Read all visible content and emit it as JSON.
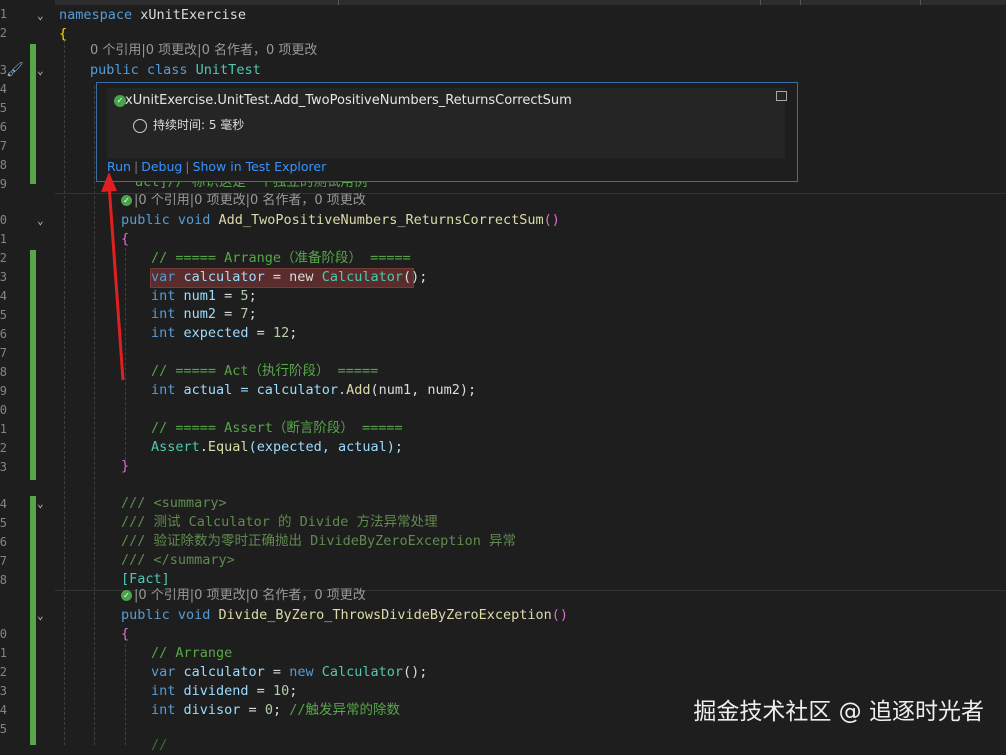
{
  "editor": {
    "line_numbers": [
      "1",
      "2",
      "",
      "3",
      "4",
      "5",
      "6",
      "7",
      "8",
      "9",
      "",
      "0",
      "1",
      "2",
      "3",
      "4",
      "5",
      "6",
      "7",
      "8",
      "9",
      "0",
      "1",
      "2",
      "3",
      "4",
      "5",
      "6",
      "7",
      "8",
      "9",
      "",
      "0",
      "1",
      "2",
      "3",
      "4",
      "5",
      "6"
    ],
    "lines": {
      "ns_kw": "namespace",
      "ns_name": " xUnitExercise",
      "open_brace_1": "{",
      "class_meta": "0 个引用|0 项更改|0 名作者，0 项更改",
      "class_kw": "public class",
      "class_name": " UnitTest",
      "fact_partial": "act]// 标识这是一个独立的测试用例",
      "method1_meta": "|0 个引用|0 项更改|0 名作者，0 项更改",
      "m1_kw": "public void",
      "m1_name": " Add_TwoPositiveNumbers_ReturnsCorrectSum",
      "m1_paren": "()",
      "m1_open": "{",
      "c_arrange": "// ===== Arrange（准备阶段） =====",
      "l_var": "var",
      "l_calc": " calculator",
      "l_eq_new": " = new ",
      "l_calc_type": "Calculator",
      "l_calc_end": "();",
      "l_int1": "int",
      "l_num1": " num1",
      "l_num1_rest": " = ",
      "l_num1_val": "5",
      "l_int2": "int",
      "l_num2": " num2",
      "l_num2_val": "7",
      "l_int3": "int",
      "l_expected": " expected",
      "l_expected_val": "12",
      "c_act": "// ===== Act（执行阶段） =====",
      "l_int4": "int",
      "l_actual": " actual",
      "l_actual_rest": " = calculator.",
      "l_add": "Add",
      "l_add_args": "(num1, num2);",
      "c_assert": "// ===== Assert（断言阶段） =====",
      "l_assert_cls": "Assert",
      "l_assert_dot": ".",
      "l_equal": "Equal",
      "l_equal_args": "(expected, actual);",
      "m1_close": "}",
      "doc1": "/// <summary>",
      "doc2": "/// 测试 Calculator 的 Divide 方法异常处理",
      "doc3": "/// 验证除数为零时正确抛出 DivideByZeroException 异常",
      "doc4": "/// </summary>",
      "fact2": "[Fact]",
      "method2_meta": "|0 个引用|0 项更改|0 名作者，0 项更改",
      "m2_kw": "public void",
      "m2_name": " Divide_ByZero_ThrowsDivideByZeroException",
      "m2_paren": "()",
      "m2_open": "{",
      "c_arrange2": "// Arrange",
      "l2_var": "var",
      "l2_calc": " calculator",
      "l2_eq": " = ",
      "l2_new": "new",
      "l2_type": " Calculator",
      "l2_end": "();",
      "l2_int1": "int",
      "l2_dividend": " dividend",
      "l2_dividend_val": "10",
      "l2_int2": "int",
      "l2_divisor": " divisor",
      "l2_divisor_val": "0",
      "l2_divisor_cm": " //触发异常的除数"
    }
  },
  "popup": {
    "title": "xUnitExercise.UnitTest.Add_TwoPositiveNumbers_ReturnsCorrectSum",
    "duration": "持续时间: 5 毫秒",
    "actions": [
      "Run",
      "Debug",
      "Show in Test Explorer"
    ]
  },
  "watermark": "掘金技术社区 @ 追逐时光者",
  "colors": {
    "background": "#1e1e1e",
    "keyword": "#569cd6",
    "type": "#4ec9b0",
    "method": "#dcdcaa",
    "comment": "#57a64a",
    "link": "#3794ff",
    "arrow": "#e02020"
  }
}
